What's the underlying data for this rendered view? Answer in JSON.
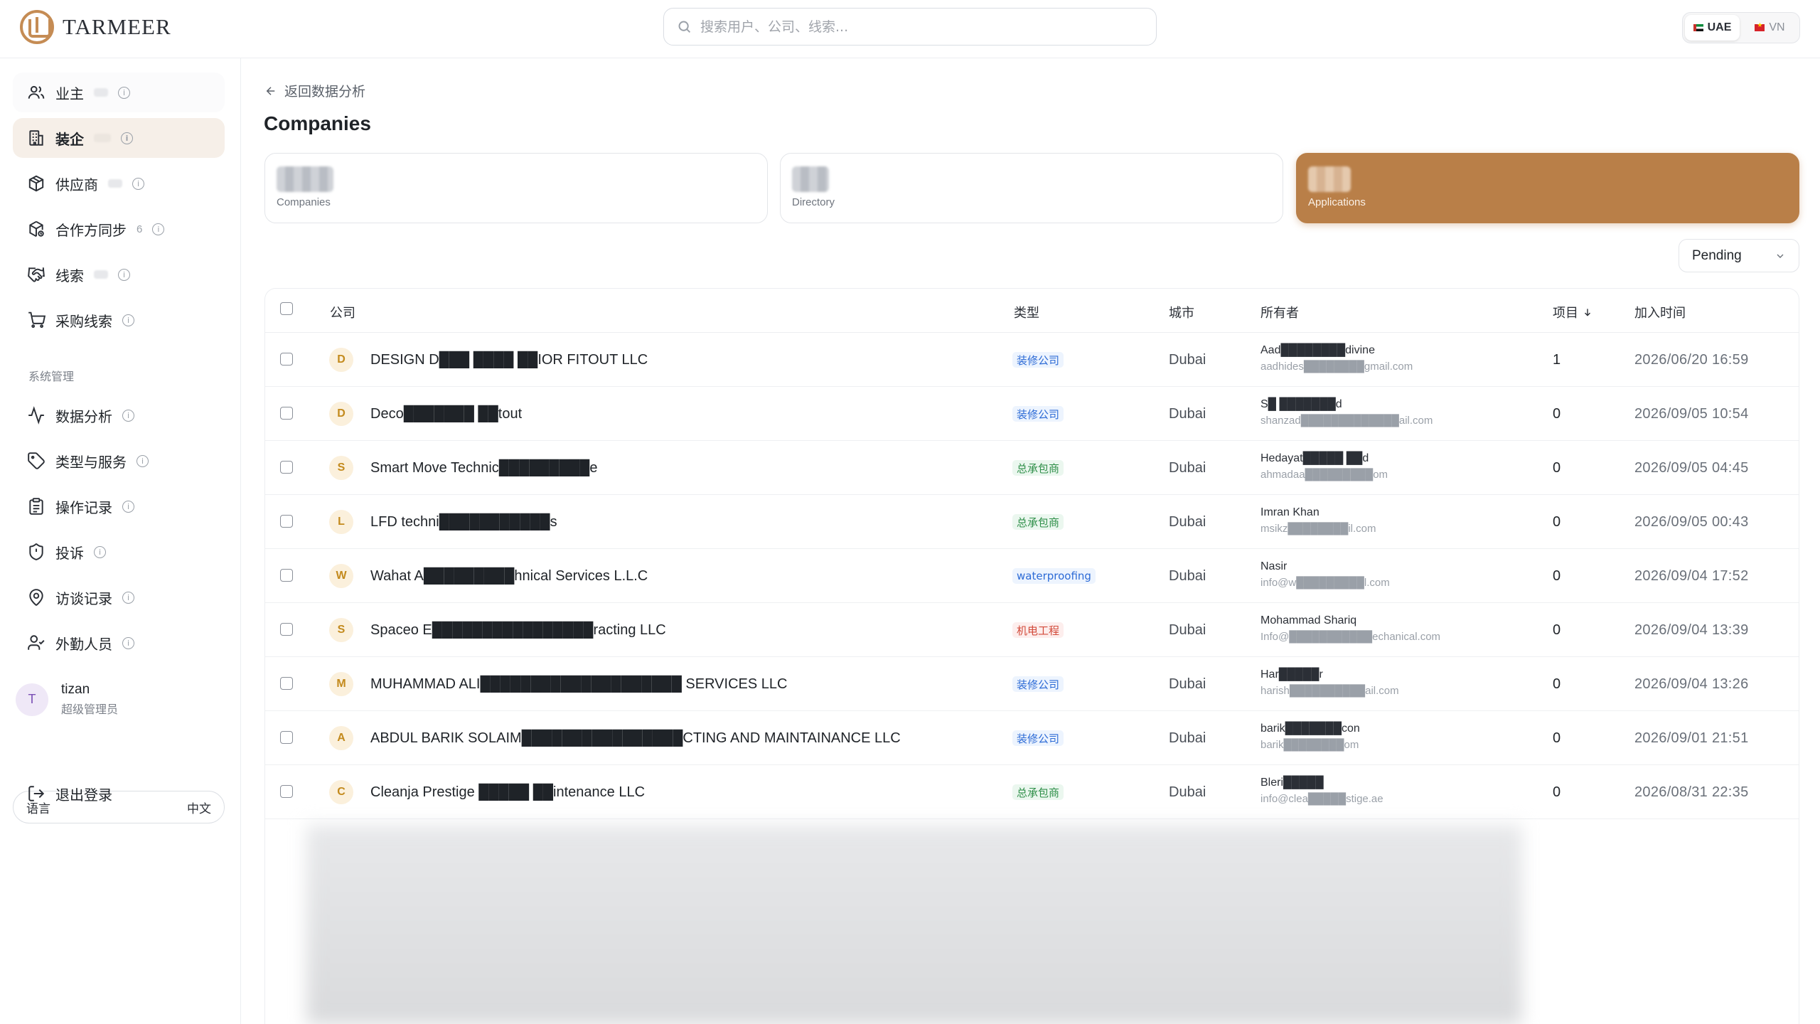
{
  "header": {
    "brand": "TARMEER",
    "search_placeholder": "搜索用户、公司、线索...",
    "regions": [
      {
        "label": "UAE",
        "active": true
      },
      {
        "label": "VN",
        "active": false
      }
    ]
  },
  "sidebar": {
    "items": [
      {
        "label": "业主",
        "icon": "users-icon"
      },
      {
        "label": "装企",
        "icon": "building-icon",
        "active": true
      },
      {
        "label": "供应商",
        "icon": "package-icon"
      },
      {
        "label": "合作方同步",
        "icon": "package-sync-icon",
        "count": "6"
      },
      {
        "label": "线索",
        "icon": "handshake-icon"
      },
      {
        "label": "采购线索",
        "icon": "cart-icon"
      }
    ],
    "section_title": "系统管理",
    "system_items": [
      {
        "label": "数据分析",
        "icon": "activity-icon"
      },
      {
        "label": "类型与服务",
        "icon": "tag-icon"
      },
      {
        "label": "操作记录",
        "icon": "clipboard-icon"
      },
      {
        "label": "投诉",
        "icon": "shield-icon"
      },
      {
        "label": "访谈记录",
        "icon": "map-pin-icon"
      },
      {
        "label": "外勤人员",
        "icon": "user-check-icon"
      }
    ],
    "user": {
      "initial": "T",
      "name": "tizan",
      "role": "超级管理员"
    },
    "language": {
      "label": "语言",
      "value": "中文"
    },
    "logout": "退出登录"
  },
  "main": {
    "back_link": "返回数据分析",
    "title": "Companies",
    "stat_cards": [
      {
        "label": "Companies",
        "active": false
      },
      {
        "label": "Directory",
        "active": false
      },
      {
        "label": "Applications",
        "active": true
      }
    ],
    "status_filter": "Pending",
    "columns": {
      "company": "公司",
      "type": "类型",
      "city": "城市",
      "owner": "所有者",
      "projects": "项目",
      "joined": "加入时间"
    },
    "rows": [
      {
        "initial": "D",
        "company": "DESIGN D███ ████ ██IOR FITOUT LLC",
        "type": "装修公司",
        "type_color": "blue",
        "city": "Dubai",
        "owner_name": "Aad████████divine",
        "owner_email": "aadhides████████gmail.com",
        "projects": "1",
        "joined": "2026/06/20 16:59"
      },
      {
        "initial": "D",
        "company": "Deco███████ ██tout",
        "type": "装修公司",
        "type_color": "blue",
        "city": "Dubai",
        "owner_name": "S█ ███████d",
        "owner_email": "shanzad█████████████ail.com",
        "projects": "0",
        "joined": "2026/09/05 10:54"
      },
      {
        "initial": "S",
        "company": "Smart Move Technic█████████e",
        "type": "总承包商",
        "type_color": "green",
        "city": "Dubai",
        "owner_name": "Hedayat█████ ██d",
        "owner_email": "ahmadaa█████████om",
        "projects": "0",
        "joined": "2026/09/05 04:45"
      },
      {
        "initial": "L",
        "company": "LFD techni███████████s",
        "type": "总承包商",
        "type_color": "green",
        "city": "Dubai",
        "owner_name": "Imran Khan",
        "owner_email": "msikz████████il.com",
        "projects": "0",
        "joined": "2026/09/05 00:43"
      },
      {
        "initial": "W",
        "company": "Wahat A█████████hnical Services L.L.C",
        "type": "waterproofing",
        "type_color": "blue",
        "city": "Dubai",
        "owner_name": "Nasir",
        "owner_email": "info@w█████████l.com",
        "projects": "0",
        "joined": "2026/09/04 17:52"
      },
      {
        "initial": "S",
        "company": "Spaceo E████████████████racting LLC",
        "type": "机电工程",
        "type_color": "red",
        "city": "Dubai",
        "owner_name": "Mohammad Shariq",
        "owner_email": "Info@███████████echanical.com",
        "projects": "0",
        "joined": "2026/09/04 13:39"
      },
      {
        "initial": "M",
        "company": "MUHAMMAD ALI████████████████████ SERVICES LLC",
        "type": "装修公司",
        "type_color": "blue",
        "city": "Dubai",
        "owner_name": "Har█████r",
        "owner_email": "harish██████████ail.com",
        "projects": "0",
        "joined": "2026/09/04 13:26"
      },
      {
        "initial": "A",
        "company": "ABDUL BARIK SOLAIM████████████████CTING AND MAINTAINANCE LLC",
        "type": "装修公司",
        "type_color": "blue",
        "city": "Dubai",
        "owner_name": "barik███████con",
        "owner_email": "barik████████om",
        "projects": "0",
        "joined": "2026/09/01 21:51"
      },
      {
        "initial": "C",
        "company": "Cleanja Prestige █████ ██intenance LLC",
        "type": "总承包商",
        "type_color": "green",
        "city": "Dubai",
        "owner_name": "Bleri█████",
        "owner_email": "info@clea█████stige.ae",
        "projects": "0",
        "joined": "2026/08/31 22:35"
      }
    ]
  }
}
